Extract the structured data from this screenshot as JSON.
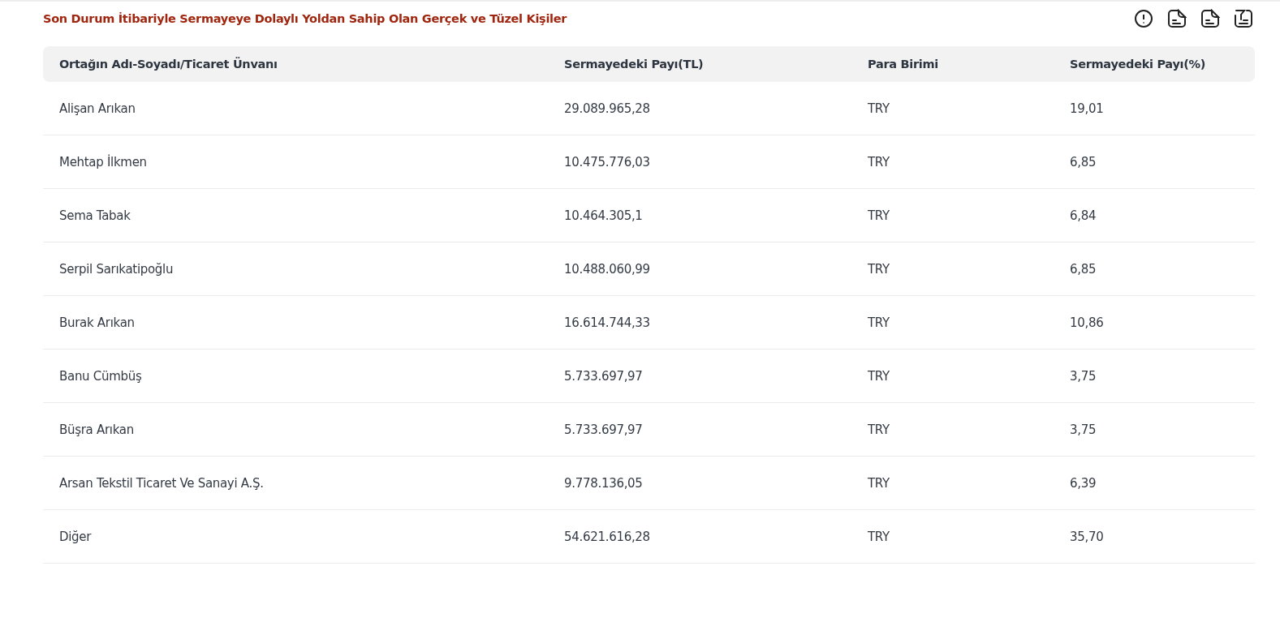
{
  "title": "Son Durum İtibariyle Sermayeye Dolaylı Yoldan Sahip Olan Gerçek ve Tüzel Kişiler",
  "toolbar": [
    {
      "kind": "info"
    },
    {
      "kind": "doc"
    },
    {
      "kind": "doc"
    },
    {
      "kind": "filter"
    }
  ],
  "table": {
    "columns": [
      "Ortağın Adı-Soyadı/Ticaret Ünvanı",
      "Sermayedeki Payı(TL)",
      "Para Birimi",
      "Sermayedeki Payı(%)"
    ],
    "rows": [
      [
        "Alişan Arıkan",
        "29.089.965,28",
        "TRY",
        "19,01"
      ],
      [
        "Mehtap İlkmen",
        "10.475.776,03",
        "TRY",
        "6,85"
      ],
      [
        "Sema Tabak",
        "10.464.305,1",
        "TRY",
        "6,84"
      ],
      [
        "Serpil Sarıkatipoğlu",
        "10.488.060,99",
        "TRY",
        "6,85"
      ],
      [
        "Burak Arıkan",
        "16.614.744,33",
        "TRY",
        "10,86"
      ],
      [
        "Banu Cümbüş",
        "5.733.697,97",
        "TRY",
        "3,75"
      ],
      [
        "Büşra Arıkan",
        "5.733.697,97",
        "TRY",
        "3,75"
      ],
      [
        "Arsan Tekstil Ticaret Ve Sanayi A.Ş.",
        "9.778.136,05",
        "TRY",
        "6,39"
      ],
      [
        "Diğer",
        "54.621.616,28",
        "TRY",
        "35,70"
      ]
    ]
  }
}
